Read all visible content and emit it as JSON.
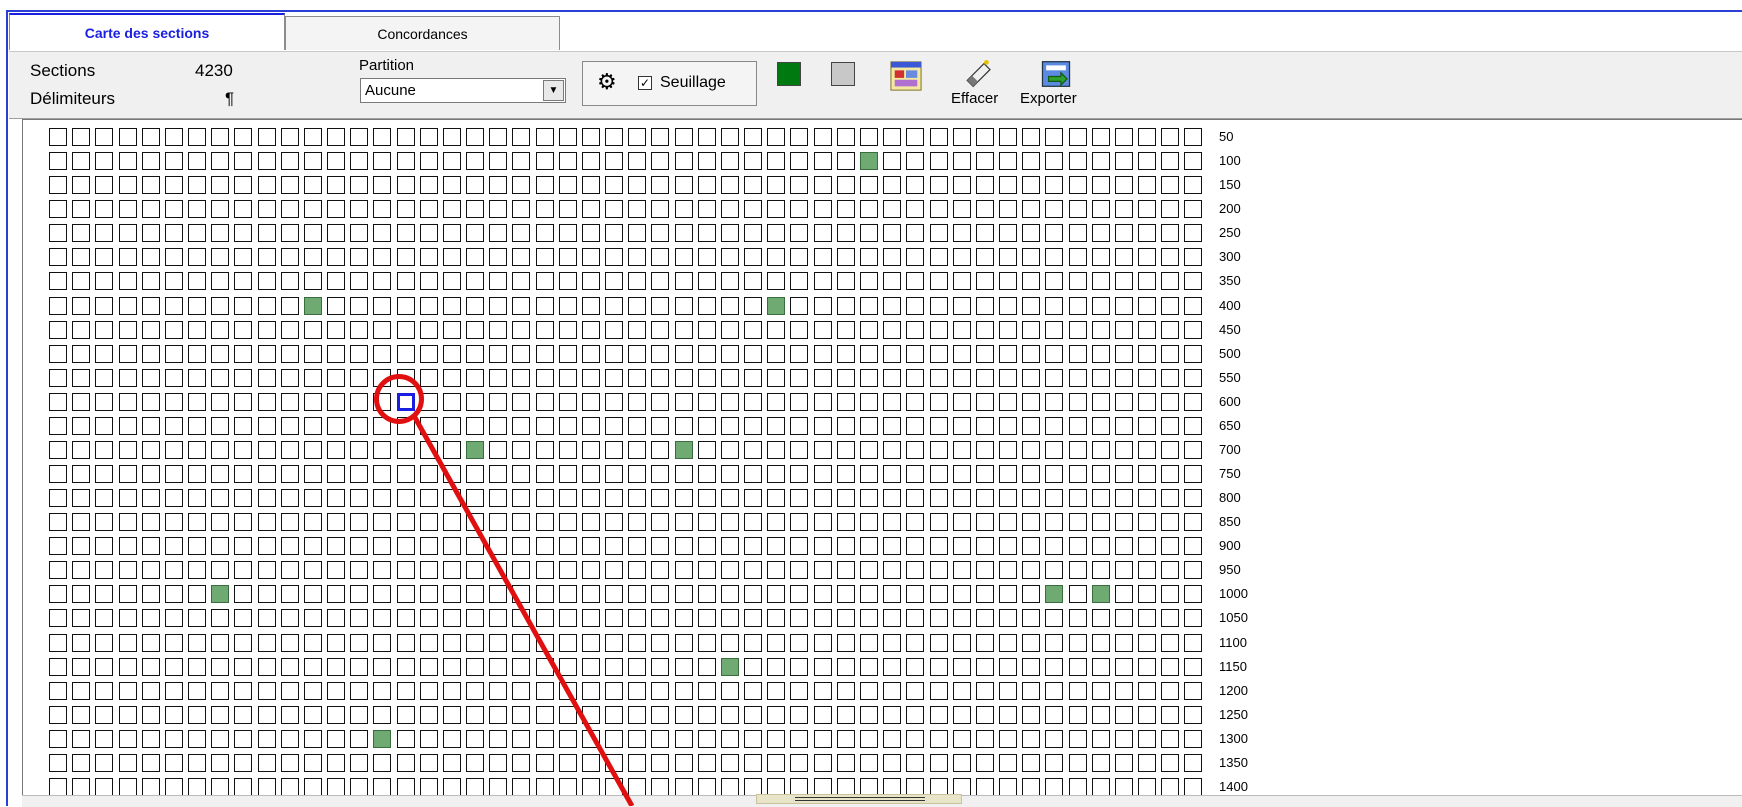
{
  "tabs": [
    {
      "label": "Carte des sections",
      "active": true
    },
    {
      "label": "Concordances",
      "active": false
    }
  ],
  "toolbar": {
    "sections_label": "Sections",
    "sections_value": "4230",
    "delimiters_label": "Délimiteurs",
    "delimiters_value": "¶",
    "partition_label": "Partition",
    "partition_value": "Aucune",
    "threshold_label": "Seuillage",
    "threshold_checked": true,
    "swatch_hit_color": "#007a10",
    "swatch_empty_color": "#c8c8c8",
    "clear_label": "Effacer",
    "export_label": "Exporter"
  },
  "grid": {
    "columns": 50,
    "row_labels": [
      "50",
      "100",
      "150",
      "200",
      "250",
      "300",
      "350",
      "400",
      "450",
      "500",
      "550",
      "600",
      "650",
      "700",
      "750",
      "800",
      "850",
      "900",
      "950",
      "1000",
      "1050",
      "1100",
      "1150",
      "1200",
      "1250",
      "1300",
      "1350",
      "1400"
    ],
    "hit_color": "#6faa72",
    "selected_color": "#1a1ee0",
    "highlighted_cells": [
      [
        1,
        35
      ],
      [
        7,
        11
      ],
      [
        7,
        31
      ],
      [
        13,
        18
      ],
      [
        13,
        27
      ],
      [
        19,
        7
      ],
      [
        19,
        43
      ],
      [
        19,
        45
      ],
      [
        22,
        29
      ],
      [
        25,
        14
      ]
    ],
    "selected_cell": [
      11,
      15
    ]
  },
  "annotation": {
    "color": "#e01010"
  }
}
